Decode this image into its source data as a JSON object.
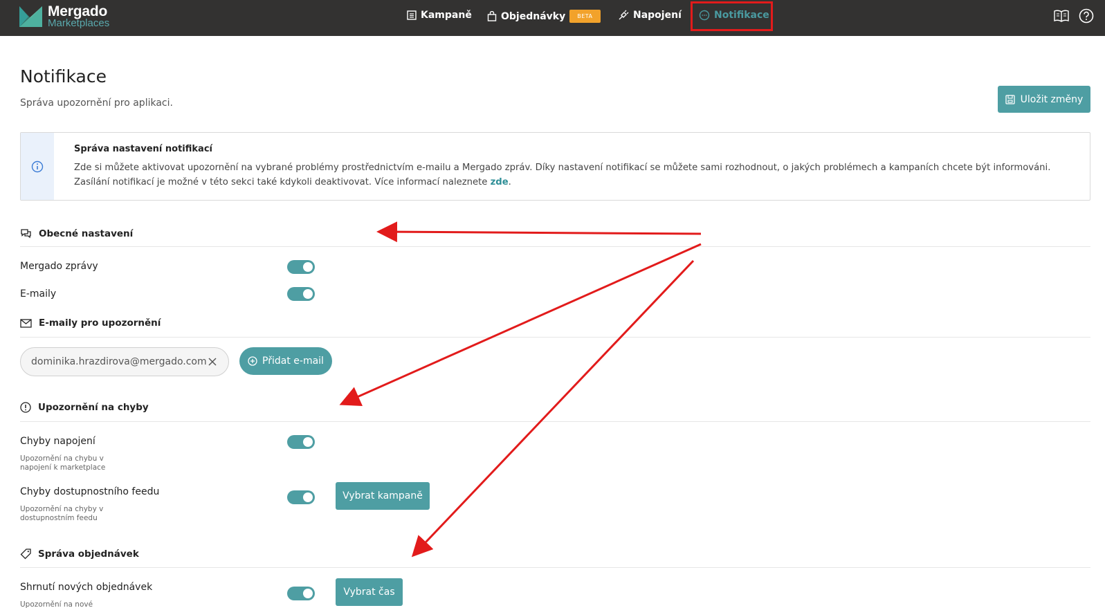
{
  "header": {
    "logo_title": "Mergado",
    "logo_subtitle": "Marketplaces",
    "nav": [
      {
        "label": "Kampaně",
        "icon": "list-icon"
      },
      {
        "label": "Objednávky",
        "icon": "bag-icon",
        "badge": "BETA"
      },
      {
        "label": "Napojení",
        "icon": "plug-icon"
      },
      {
        "label": "Notifikace",
        "icon": "chat-icon",
        "active": true
      }
    ],
    "right_icons": [
      "book-icon",
      "help-icon"
    ]
  },
  "page": {
    "title": "Notifikace",
    "subtitle": "Správa upozornění pro aplikaci.",
    "save_label": "Uložit změny"
  },
  "info": {
    "title": "Správa nastavení notifikací",
    "text": "Zde si můžete aktivovat upozornění na vybrané problémy prostřednictvím e-mailu a Mergado zpráv. Díky nastavení notifikací se můžete sami rozhodnout, o jakých problémech a kampaních chcete být informováni. Zasílání notifikací je možné v této sekci také kdykoli deaktivovat. Více informací naleznete ",
    "link": "zde",
    "tail": "."
  },
  "general": {
    "title": "Obecné nastavení",
    "mergado_messages": "Mergado zprávy",
    "emails": "E-maily"
  },
  "emails_section": {
    "title": "E-maily pro upozornění",
    "email_value": "dominika.hrazdirova@mergado.com",
    "add_label": "Přidat e-mail"
  },
  "errors": {
    "title": "Upozornění na chyby",
    "connection_label": "Chyby napojení",
    "connection_sub": "Upozornění na chybu v napojení k marketplace",
    "feed_label": "Chyby dostupnostního feedu",
    "feed_sub": "Upozornění na chyby v dostupnostním feedu",
    "select_campaigns": "Vybrat kampaně"
  },
  "orders": {
    "title": "Správa objednávek",
    "summary_label": "Shrnutí nových objednávek",
    "summary_sub": "Upozornění na nové",
    "select_time": "Vybrat čas"
  },
  "colors": {
    "topbar": "#333231",
    "accent": "#4e9ea3",
    "beta": "#f2a22b",
    "annotation": "#e21b1b"
  }
}
